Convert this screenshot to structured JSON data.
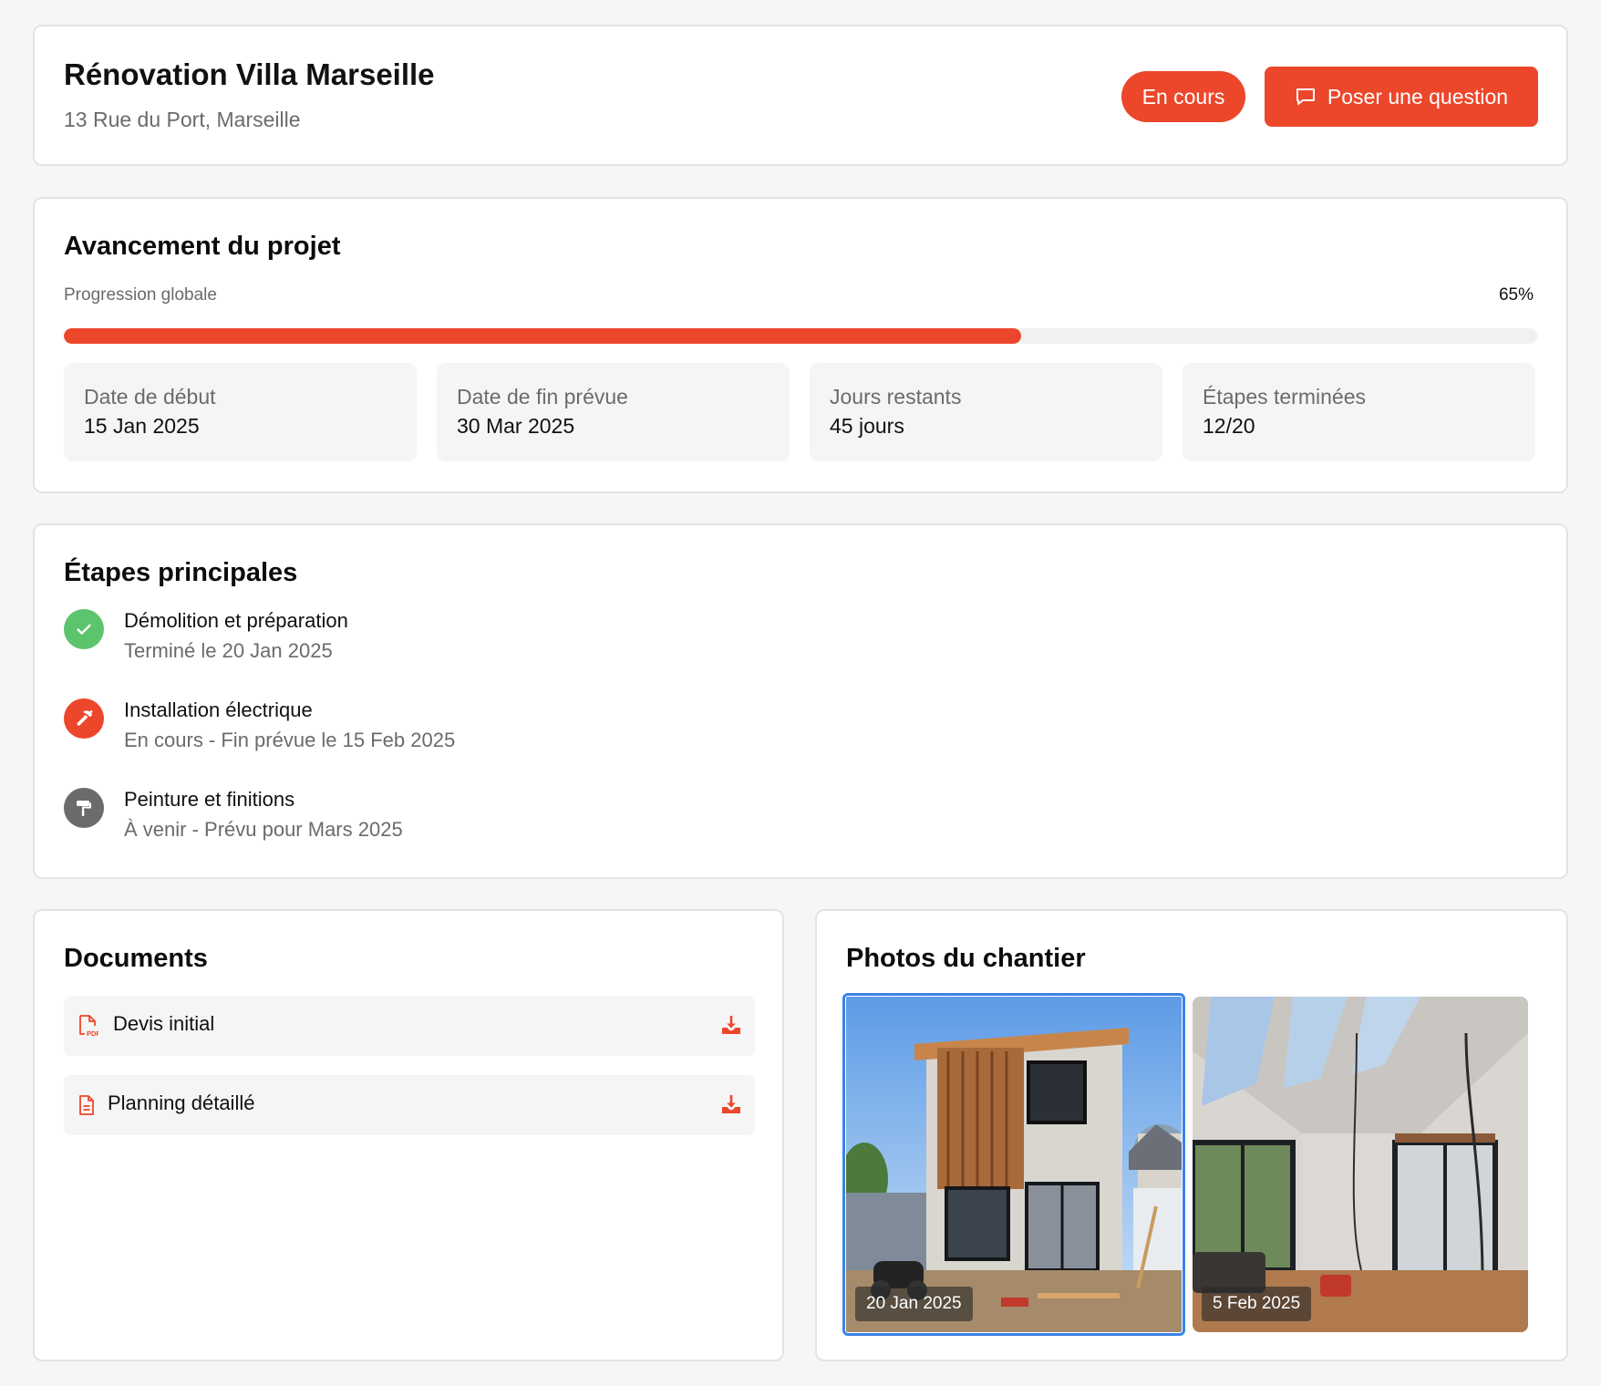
{
  "header": {
    "title": "Rénovation Villa Marseille",
    "address": "13 Rue du Port, Marseille",
    "status": "En cours",
    "ask_button": "Poser une question",
    "ask_icon": "chat-bubble-icon"
  },
  "progress": {
    "heading": "Avancement du projet",
    "label": "Progression globale",
    "value_text": "65%",
    "value": 65,
    "stats": [
      {
        "label": "Date de début",
        "value": "15 Jan 2025"
      },
      {
        "label": "Date de fin prévue",
        "value": "30 Mar 2025"
      },
      {
        "label": "Jours restants",
        "value": "45 jours"
      },
      {
        "label": "Étapes terminées",
        "value": "12/20"
      }
    ]
  },
  "steps": {
    "heading": "Étapes principales",
    "items": [
      {
        "title": "Démolition et préparation",
        "subtitle": "Terminé le 20 Jan 2025",
        "icon": "check-icon",
        "color": "#5cc46d"
      },
      {
        "title": "Installation électrique",
        "subtitle": "En cours - Fin prévue le 15 Feb 2025",
        "icon": "hammer-icon",
        "color": "#ec472b"
      },
      {
        "title": "Peinture et finitions",
        "subtitle": "À venir - Prévu pour Mars 2025",
        "icon": "paint-roller-icon",
        "color": "#6b6b6b"
      }
    ]
  },
  "documents": {
    "heading": "Documents",
    "items": [
      {
        "name": "Devis initial",
        "icon": "pdf-file-icon"
      },
      {
        "name": "Planning détaillé",
        "icon": "document-file-icon"
      }
    ]
  },
  "photos": {
    "heading": "Photos du chantier",
    "items": [
      {
        "date": "20 Jan 2025",
        "selected": true
      },
      {
        "date": "5 Feb 2025",
        "selected": false
      }
    ]
  },
  "colors": {
    "accent": "#ec472b",
    "success": "#5cc46d",
    "muted": "#6b6b6b",
    "selection": "#3b82e6"
  }
}
